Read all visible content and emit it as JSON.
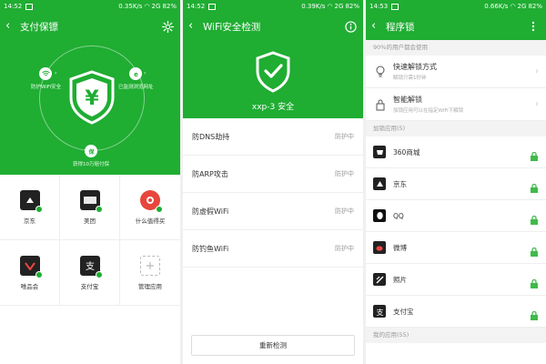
{
  "colors": {
    "brand_green": "#1fad32"
  },
  "screen1": {
    "status": {
      "time": "14:52",
      "net": "0.35K/s",
      "signal": "2G",
      "battery": "82%"
    },
    "title": "支付保镖",
    "nodes": {
      "wifi": "防护WiFi安全",
      "browser": "已监测浏览网址",
      "shield": "获得10万赔付保"
    },
    "apps": [
      {
        "label": "京东",
        "color": "#222222"
      },
      {
        "label": "美团",
        "color": "#222222"
      },
      {
        "label": "什么值得买",
        "color": "#e7463c"
      },
      {
        "label": "唯品会",
        "color": "#222222"
      },
      {
        "label": "支付宝",
        "color": "#222222"
      },
      {
        "label": "管理应用",
        "color": "#ffffff"
      }
    ]
  },
  "screen2": {
    "status": {
      "time": "14:52",
      "net": "0.39K/s",
      "signal": "2G",
      "battery": "82%"
    },
    "title": "WiFi安全检测",
    "network": "xxp-3 安全",
    "items": [
      {
        "label": "防DNS劫持",
        "state": "防护中"
      },
      {
        "label": "防ARP攻击",
        "state": "防护中"
      },
      {
        "label": "防虚假WiFi",
        "state": "防护中"
      },
      {
        "label": "防钓鱼WiFi",
        "state": "防护中"
      }
    ],
    "retest": "重新检测"
  },
  "screen3": {
    "status": {
      "time": "14:53",
      "net": "0.66K/s",
      "signal": "2G",
      "battery": "82%"
    },
    "title": "程序锁",
    "notice": "90%的用户都会使用",
    "options": [
      {
        "title": "快速解锁方式",
        "sub": "解锁只需1秒钟"
      },
      {
        "title": "智能解锁",
        "sub": "加锁应用可以在指定WiFi下解锁"
      }
    ],
    "locked_header": "加锁应用(5)",
    "locked_apps": [
      {
        "name": "360商城",
        "color": "#222222"
      },
      {
        "name": "京东",
        "color": "#222222"
      },
      {
        "name": "QQ",
        "color": "#111111"
      },
      {
        "name": "微博",
        "color": "#222222"
      },
      {
        "name": "照片",
        "color": "#222222"
      },
      {
        "name": "支付宝",
        "color": "#222222"
      }
    ],
    "my_header": "我的应用(55)"
  }
}
